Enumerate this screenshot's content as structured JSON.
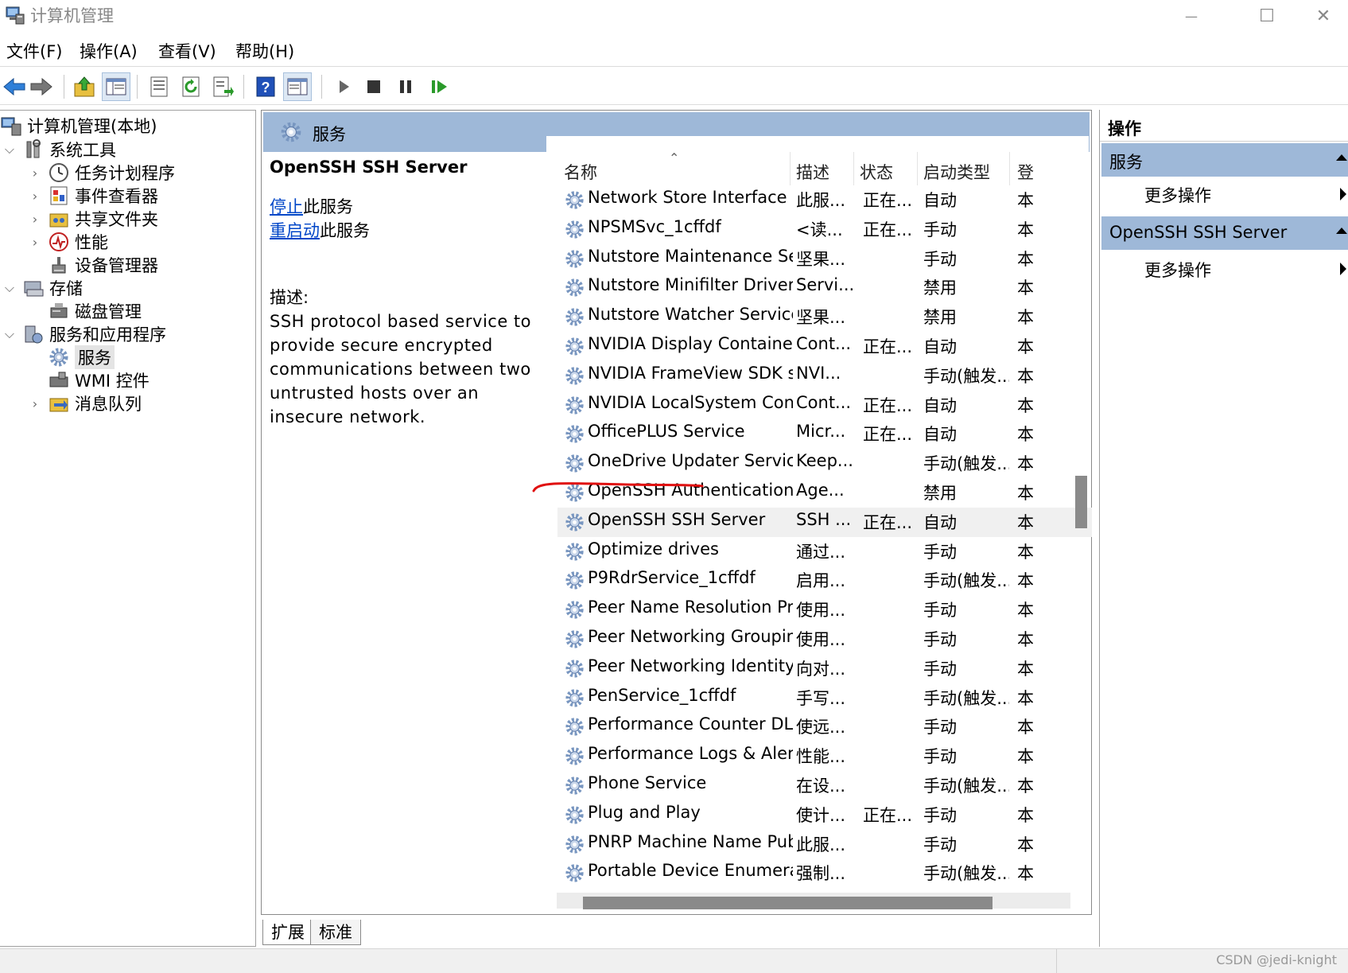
{
  "window": {
    "title": "计算机管理",
    "minimize_glyph": "—",
    "maximize_glyph": "☐",
    "close_glyph": "✕"
  },
  "menu": [
    "文件(F)",
    "操作(A)",
    "查看(V)",
    "帮助(H)"
  ],
  "tree": {
    "root": "计算机管理(本地)",
    "system_tools": "系统工具",
    "task_scheduler": "任务计划程序",
    "event_viewer": "事件查看器",
    "shared_folders": "共享文件夹",
    "performance": "性能",
    "device_manager": "设备管理器",
    "storage": "存储",
    "disk_management": "磁盘管理",
    "services_apps": "服务和应用程序",
    "services": "服务",
    "wmi": "WMI 控件",
    "message_queue": "消息队列",
    "expanded_glyph": "⌵",
    "collapsed_glyph": "›"
  },
  "center": {
    "title": "服务",
    "selected_service": "OpenSSH SSH Server",
    "stop_link": "停止",
    "stop_suffix": "此服务",
    "restart_link": "重启动",
    "restart_suffix": "此服务",
    "desc_label": "描述:",
    "desc_text": "SSH protocol based service to provide secure encrypted communications between two untrusted hosts over an insecure network.",
    "sort_glyph": "⌃"
  },
  "columns": {
    "name": "名称",
    "description": "描述",
    "status": "状态",
    "startup": "启动类型",
    "logon": "登"
  },
  "services": [
    {
      "name": "Network Store Interface Se...",
      "desc": "此服...",
      "state": "正在...",
      "start": "自动",
      "logon": "本"
    },
    {
      "name": "NPSMSvc_1cffdf",
      "desc": "<读...",
      "state": "正在...",
      "start": "手动",
      "logon": "本"
    },
    {
      "name": "Nutstore Maintenance Ser...",
      "desc": "坚果...",
      "state": "",
      "start": "手动",
      "logon": "本"
    },
    {
      "name": "Nutstore Minifilter Driver S...",
      "desc": "Servi...",
      "state": "",
      "start": "禁用",
      "logon": "本"
    },
    {
      "name": "Nutstore Watcher Service",
      "desc": "坚果...",
      "state": "",
      "start": "禁用",
      "logon": "本"
    },
    {
      "name": "NVIDIA Display Container LS",
      "desc": "Cont...",
      "state": "正在...",
      "start": "自动",
      "logon": "本"
    },
    {
      "name": "NVIDIA FrameView SDK se...",
      "desc": "NVI...",
      "state": "",
      "start": "手动(触发...",
      "logon": "本"
    },
    {
      "name": "NVIDIA LocalSystem Conta...",
      "desc": "Cont...",
      "state": "正在...",
      "start": "自动",
      "logon": "本"
    },
    {
      "name": "OfficePLUS Service",
      "desc": "Micr...",
      "state": "正在...",
      "start": "自动",
      "logon": "本"
    },
    {
      "name": "OneDrive Updater Service",
      "desc": "Keep...",
      "state": "",
      "start": "手动(触发...",
      "logon": "本"
    },
    {
      "name": "OpenSSH Authentication ...",
      "desc": "Age...",
      "state": "",
      "start": "禁用",
      "logon": "本"
    },
    {
      "name": "OpenSSH SSH Server",
      "desc": "SSH ...",
      "state": "正在...",
      "start": "自动",
      "logon": "本"
    },
    {
      "name": "Optimize drives",
      "desc": "通过...",
      "state": "",
      "start": "手动",
      "logon": "本"
    },
    {
      "name": "P9RdrService_1cffdf",
      "desc": "启用...",
      "state": "",
      "start": "手动(触发...",
      "logon": "本"
    },
    {
      "name": "Peer Name Resolution Pro...",
      "desc": "使用...",
      "state": "",
      "start": "手动",
      "logon": "本"
    },
    {
      "name": "Peer Networking Grouping",
      "desc": "使用...",
      "state": "",
      "start": "手动",
      "logon": "本"
    },
    {
      "name": "Peer Networking Identity ...",
      "desc": "向对...",
      "state": "",
      "start": "手动",
      "logon": "本"
    },
    {
      "name": "PenService_1cffdf",
      "desc": "手写...",
      "state": "",
      "start": "手动(触发...",
      "logon": "本"
    },
    {
      "name": "Performance Counter DLL ...",
      "desc": "使远...",
      "state": "",
      "start": "手动",
      "logon": "本"
    },
    {
      "name": "Performance Logs & Alerts",
      "desc": "性能...",
      "state": "",
      "start": "手动",
      "logon": "本"
    },
    {
      "name": "Phone Service",
      "desc": "在设...",
      "state": "",
      "start": "手动(触发...",
      "logon": "本"
    },
    {
      "name": "Plug and Play",
      "desc": "使计...",
      "state": "正在...",
      "start": "手动",
      "logon": "本"
    },
    {
      "name": "PNRP Machine Name Publ...",
      "desc": "此服...",
      "state": "",
      "start": "手动",
      "logon": "本"
    },
    {
      "name": "Portable Device Enumerat...",
      "desc": "强制...",
      "state": "",
      "start": "手动(触发...",
      "logon": "本"
    }
  ],
  "selected_index": 11,
  "tabs": [
    "扩展",
    "标准"
  ],
  "actions": {
    "title": "操作",
    "section1": "服务",
    "more1": "更多操作",
    "section2": "OpenSSH SSH Server",
    "more2": "更多操作"
  },
  "watermark": "CSDN @jedi-knight",
  "colors": {
    "header_blue": "#9eb8d8",
    "link_blue": "#0046c8",
    "annotation_red": "#e01010"
  }
}
